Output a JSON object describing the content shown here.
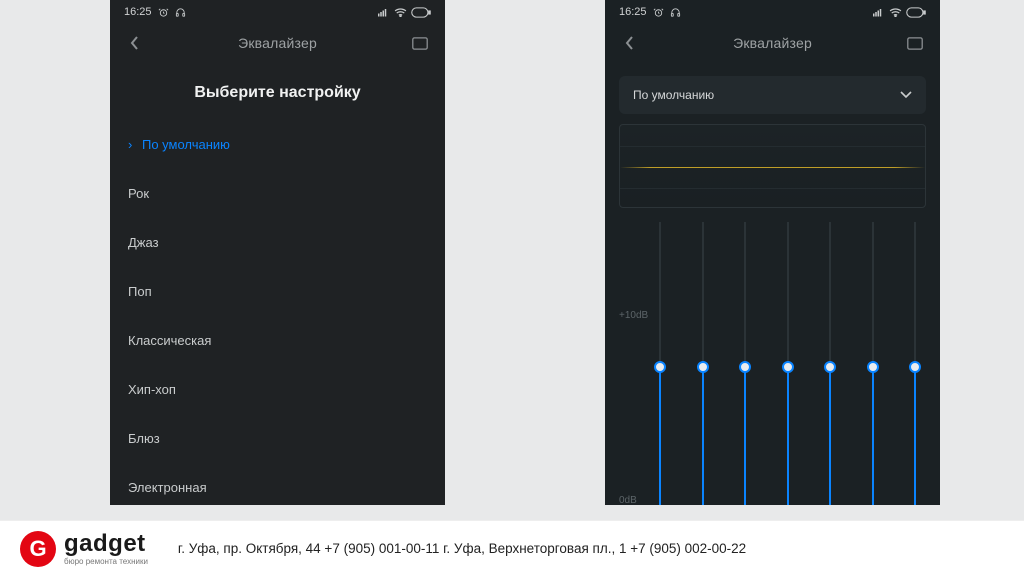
{
  "status": {
    "time": "16:25"
  },
  "nav": {
    "title": "Эквалайзер"
  },
  "left": {
    "section_title": "Выберите настройку",
    "presets": [
      "По умолчанию",
      "Рок",
      "Джаз",
      "Поп",
      "Классическая",
      "Хип-хоп",
      "Блюз",
      "Электронная"
    ],
    "selected_index": 0
  },
  "right": {
    "selected_preset": "По умолчанию",
    "db_top": "+10dB",
    "db_bottom": "0dB",
    "band_count": 7
  },
  "footer": {
    "brand": "gadget",
    "brand_sub": "бюро ремонта техники",
    "contacts": "г. Уфа, пр. Октября, 44   +7 (905) 001-00-11 г. Уфа, Верхнеторговая пл., 1   +7 (905) 002-00-22"
  }
}
